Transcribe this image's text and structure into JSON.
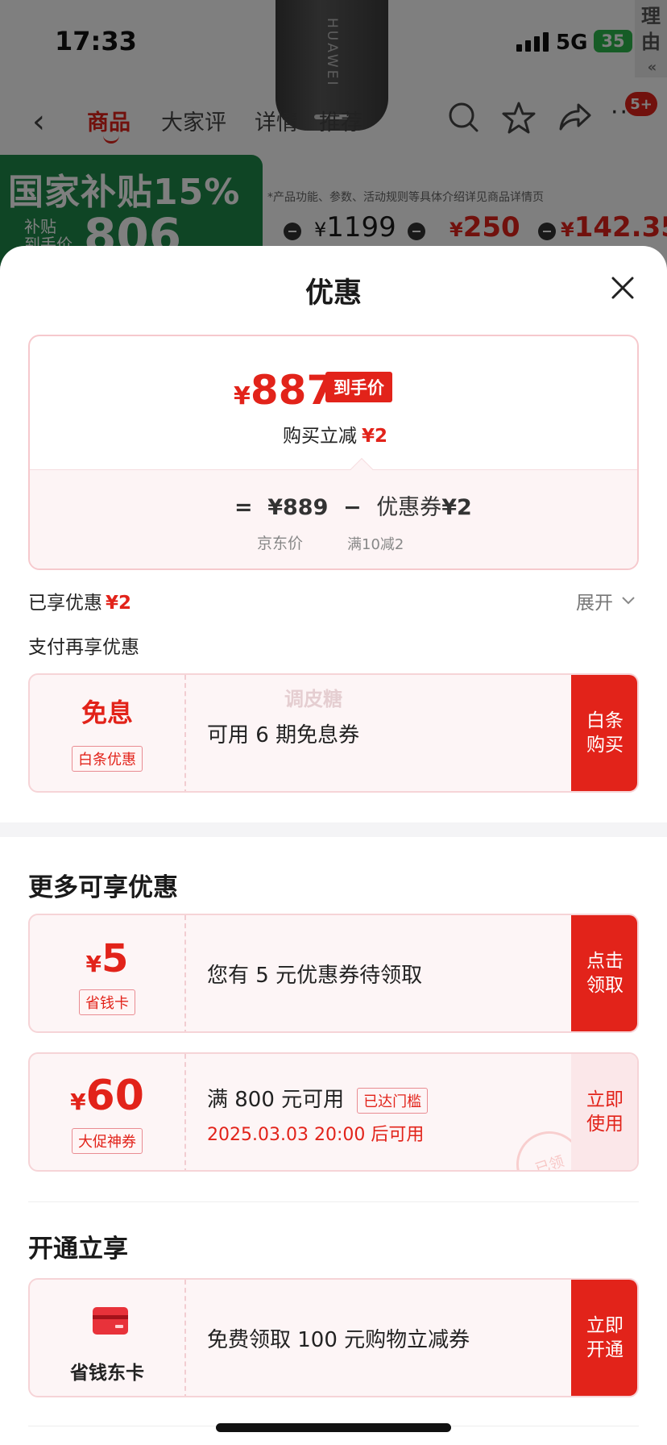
{
  "status_bar": {
    "time": "17:33",
    "network": "5G",
    "battery": "35"
  },
  "product_page": {
    "brand_text": "HUAWEI",
    "side_tab_chars": [
      "理",
      "由"
    ],
    "side_tab_chevrons": "«",
    "tabs": [
      "商品",
      "大家评",
      "详情",
      "推荐"
    ],
    "cart_badge": "5+",
    "subsidy_title": "国家补贴15%",
    "subsidy_label": "补贴\n到手价",
    "subsidy_price": "806",
    "disclaimer": "*产品功能、参数、活动规则等具体介绍详见商品详情页",
    "price_1": "1199",
    "price_2": "250",
    "price_3": "142.35",
    "currency": "¥"
  },
  "sheet": {
    "title": "优惠",
    "summary": {
      "currency": "¥",
      "hand_price": "887",
      "hand_price_tag": "到手价",
      "instant_label": "购买立减",
      "instant_value": "¥2",
      "equals": "=",
      "jd_price": "¥889",
      "minus": "−",
      "coupon_label": "优惠券",
      "coupon_value": "¥2",
      "jd_price_label": "京东价",
      "coupon_rule": "满10减2"
    },
    "enjoyed_label": "已享优惠",
    "enjoyed_value": "¥2",
    "expand_label": "展开",
    "pay_title": "支付再享优惠",
    "baitiao_card": {
      "main": "免息",
      "tag": "白条优惠",
      "desc": "可用 6 期免息券",
      "action_line1": "白条",
      "action_line2": "购买",
      "watermark": "调皮糖"
    },
    "more_title": "更多可享优惠",
    "savings_card": {
      "currency": "¥",
      "amount": "5",
      "tag": "省钱卡",
      "desc": "您有 5 元优惠券待领取",
      "action_line1": "点击",
      "action_line2": "领取"
    },
    "promo_card": {
      "currency": "¥",
      "amount": "60",
      "tag": "大促神券",
      "desc": "满 800 元可用",
      "threshold_tag": "已达门槛",
      "time": "2025.03.03 20:00 后可用",
      "action_line1": "立即",
      "action_line2": "使用",
      "stamp": "已领"
    },
    "open_title": "开通立享",
    "jdcard_card": {
      "name": "省钱东卡",
      "desc": "免费领取 100 元购物立减券",
      "action_line1": "立即",
      "action_line2": "开通"
    }
  },
  "colors": {
    "accent": "#e2231a",
    "green": "#1e8a4a",
    "card_bg": "#fdf5f6"
  }
}
